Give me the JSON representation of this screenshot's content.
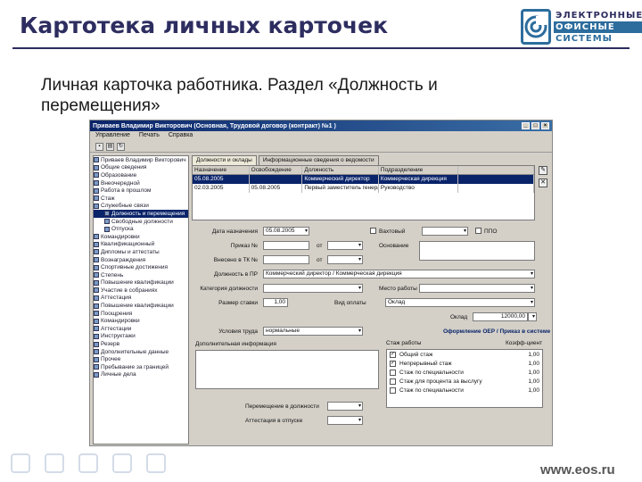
{
  "slide": {
    "title": "Картотека личных карточек",
    "subtitle": "Личная карточка работника. Раздел «Должность и перемещения»",
    "url": "www.eos.ru",
    "logo": {
      "line1": "ЭЛЕКТРОННЫЕ",
      "line2": "ОФИСНЫЕ",
      "line3": "СИСТЕМЫ"
    }
  },
  "window": {
    "title": "Приваев Владимир Викторович (Основная, Трудовой договор (контракт) №1 )",
    "menu": [
      "Управление",
      "Печать",
      "Справка"
    ],
    "tree": [
      {
        "label": "Приваев Владимир Викторович",
        "sub": false,
        "selected": false
      },
      {
        "label": "Общие сведения",
        "sub": false,
        "selected": false
      },
      {
        "label": "Образование",
        "sub": false,
        "selected": false
      },
      {
        "label": "Внеочередной",
        "sub": false,
        "selected": false
      },
      {
        "label": "Работа в прошлом",
        "sub": false,
        "selected": false
      },
      {
        "label": "Стаж",
        "sub": false,
        "selected": false
      },
      {
        "label": "Служебные связи",
        "sub": false,
        "selected": false
      },
      {
        "label": "Должность и перемещения",
        "sub": true,
        "selected": true
      },
      {
        "label": "Свободные должности",
        "sub": true,
        "selected": false
      },
      {
        "label": "Отпуска",
        "sub": true,
        "selected": false
      },
      {
        "label": "Командировки",
        "sub": false,
        "selected": false
      },
      {
        "label": "Квалификационный",
        "sub": false,
        "selected": false
      },
      {
        "label": "Дипломы и аттестаты",
        "sub": false,
        "selected": false
      },
      {
        "label": "Вознаграждения",
        "sub": false,
        "selected": false
      },
      {
        "label": "Спортивные достижения",
        "sub": false,
        "selected": false
      },
      {
        "label": "Степень",
        "sub": false,
        "selected": false
      },
      {
        "label": "Повышение квалификации",
        "sub": false,
        "selected": false
      },
      {
        "label": "Участие в собраниях",
        "sub": false,
        "selected": false
      },
      {
        "label": "Аттестация",
        "sub": false,
        "selected": false
      },
      {
        "label": "Повышение квалификации",
        "sub": false,
        "selected": false
      },
      {
        "label": "Поощрения",
        "sub": false,
        "selected": false
      },
      {
        "label": "Командировки",
        "sub": false,
        "selected": false
      },
      {
        "label": "Аттестации",
        "sub": false,
        "selected": false
      },
      {
        "label": "Инструктажи",
        "sub": false,
        "selected": false
      },
      {
        "label": "Резерв",
        "sub": false,
        "selected": false
      },
      {
        "label": "Дополнительные данные",
        "sub": false,
        "selected": false
      },
      {
        "label": "Прочее",
        "sub": false,
        "selected": false
      },
      {
        "label": "Пребывание за границей",
        "sub": false,
        "selected": false
      },
      {
        "label": "Личные дела",
        "sub": false,
        "selected": false
      }
    ],
    "tabs": [
      "Должности и оклады",
      "Информационные сведения о ведомости"
    ],
    "table_headers": [
      "Назначение",
      "Освобождение",
      "Должность",
      "Подразделение"
    ],
    "table_rows": [
      {
        "start": "05.08.2005",
        "end": "",
        "pos": "Коммерческий директор",
        "dept": "Коммерческая дирекция"
      },
      {
        "start": "02.03.2005",
        "end": "05.08.2005",
        "pos": "Первый заместитель генерального",
        "dept": "Руководство"
      }
    ],
    "form": {
      "date_label": "Дата назначения",
      "date_value": "05.08.2005",
      "order_label": "Приказ №",
      "order_from": "от",
      "entry_label": "Внесено в ТК №",
      "entry_from": "от",
      "position_label": "Должность в ПР",
      "position_value": "Коммерческий директор / Коммерческая дирекция",
      "category_label": "Категория должности",
      "place_label": "Место работы",
      "rate_label": "Размер ставки",
      "rate_value": "1,00",
      "salary_group_label": "Вид оплаты",
      "salary_group_value": "Оклад",
      "salary_label": "Оклад",
      "salary_value": "12000,00",
      "check1_label": "Вахтовый",
      "check2_label": "ППО",
      "reason_label": "Основание",
      "conditions_label": "Условия труда",
      "conditions_value": "нормальные",
      "link_label": "Оформление ОЕР / Приказ в системе",
      "addinfo_label": "Дополнительная информация",
      "move_label": "Перемещение в должности",
      "leave_label": "Аттестация в отпуске",
      "grid_title": "Стаж работы",
      "grid_col": "Коэфф-циент",
      "grid_rows": [
        {
          "checked": true,
          "name": "Общий стаж",
          "val": "1,00"
        },
        {
          "checked": true,
          "name": "Непрерывный стаж",
          "val": "1,00"
        },
        {
          "checked": false,
          "name": "Стаж по специальности",
          "val": "1,00"
        },
        {
          "checked": false,
          "name": "Стаж для процента за выслугу",
          "val": "1,00"
        },
        {
          "checked": false,
          "name": "Стаж по специальности",
          "val": "1,00"
        }
      ]
    }
  }
}
